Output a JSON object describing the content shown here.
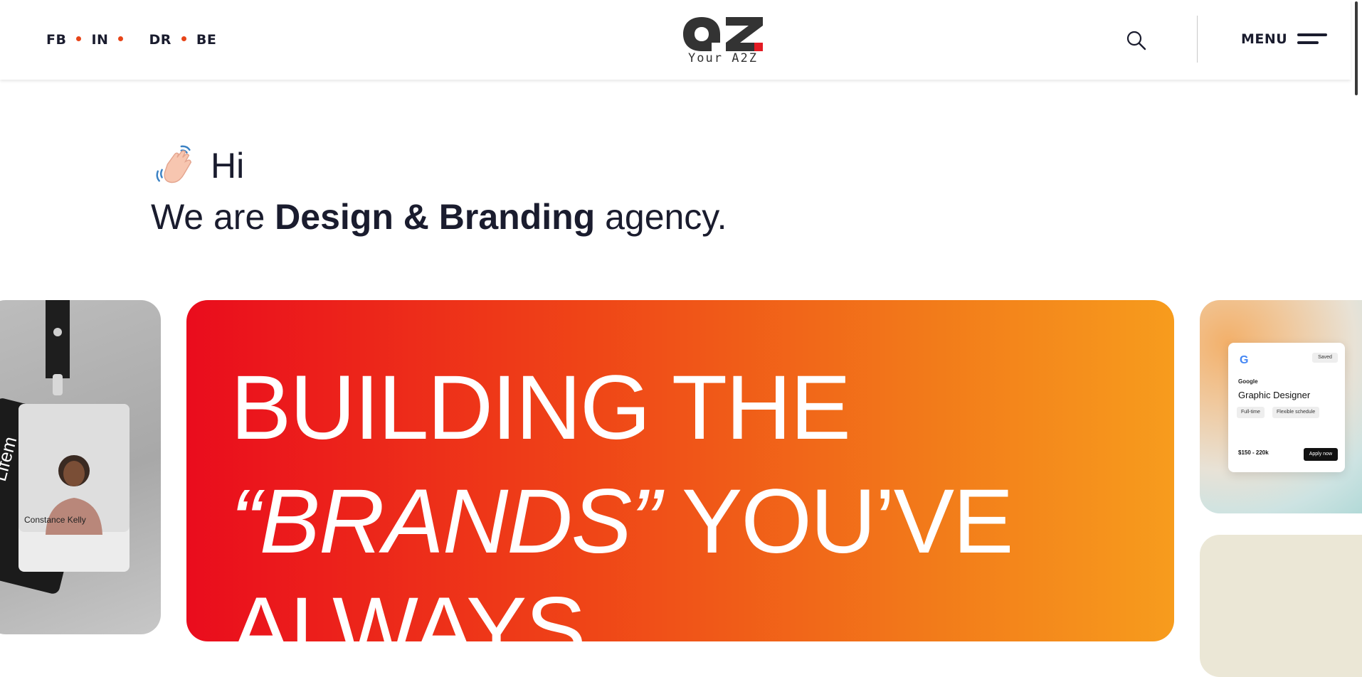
{
  "header": {
    "social_links": [
      {
        "label": "FB"
      },
      {
        "label": "IN"
      },
      {
        "label": "DR"
      },
      {
        "label": "BE"
      }
    ],
    "logo": {
      "mark": "aZ",
      "tagline": "Your A2Z"
    },
    "menu_label": "MENU"
  },
  "intro": {
    "emoji": "waving-hand-icon",
    "greeting": "Hi",
    "tagline_prefix": "We are ",
    "tagline_bold": "Design & Branding",
    "tagline_suffix": " agency."
  },
  "hero": {
    "line1": "BUILDING THE",
    "line2_italic": "“BRANDS”",
    "line2_rest": " YOU’VE",
    "line3": "ALWAYS"
  },
  "cards": {
    "badge_card": {
      "name": "Constance Kelly",
      "text_fragment": "Lifem"
    },
    "job_card": {
      "company": "Google",
      "title": "Graphic Designer",
      "chips": [
        "Full-time",
        "Flexible schedule"
      ],
      "salary": "$150 - 220k",
      "apply_label": "Apply now",
      "saved_label": "Saved"
    }
  },
  "colors": {
    "accent_dot": "#e74418",
    "hero_gradient_start": "#ea0c1d",
    "hero_gradient_end": "#f79c1d",
    "text": "#1a1c2e"
  }
}
